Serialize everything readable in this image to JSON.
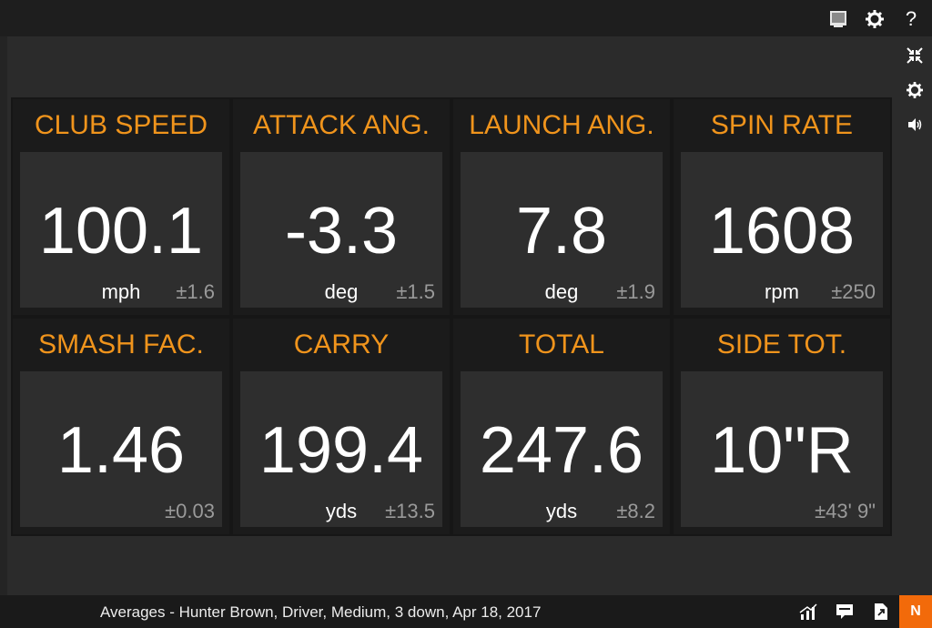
{
  "colors": {
    "accent": "#f0941c",
    "badge": "#f26a0a",
    "tolerance": "#9a9a9a"
  },
  "top_icons": [
    "display-icon",
    "gear-icon",
    "help-icon"
  ],
  "help_label": "?",
  "rail_icons": [
    "collapse-icon",
    "gear-icon",
    "speaker-icon"
  ],
  "tiles": [
    {
      "title": "CLUB SPEED",
      "value": "100.1",
      "unit": "mph",
      "tolerance": "±1.6"
    },
    {
      "title": "ATTACK ANG.",
      "value": "-3.3",
      "unit": "deg",
      "tolerance": "±1.5"
    },
    {
      "title": "LAUNCH ANG.",
      "value": "7.8",
      "unit": "deg",
      "tolerance": "±1.9"
    },
    {
      "title": "SPIN RATE",
      "value": "1608",
      "unit": "rpm",
      "tolerance": "±250"
    },
    {
      "title": "SMASH FAC.",
      "value": "1.46",
      "unit": "",
      "tolerance": "±0.03"
    },
    {
      "title": "CARRY",
      "value": "199.4",
      "unit": "yds",
      "tolerance": "±13.5"
    },
    {
      "title": "TOTAL",
      "value": "247.6",
      "unit": "yds",
      "tolerance": "±8.2"
    },
    {
      "title": "SIDE TOT.",
      "value": "10\"R",
      "unit": "",
      "tolerance": "±43' 9\""
    }
  ],
  "status": {
    "text": "Averages - Hunter Brown, Driver, Medium, 3 down, Apr 18, 2017"
  },
  "bottom_icons": [
    "chart-icon",
    "comment-icon",
    "export-icon"
  ],
  "badge_label": "N"
}
